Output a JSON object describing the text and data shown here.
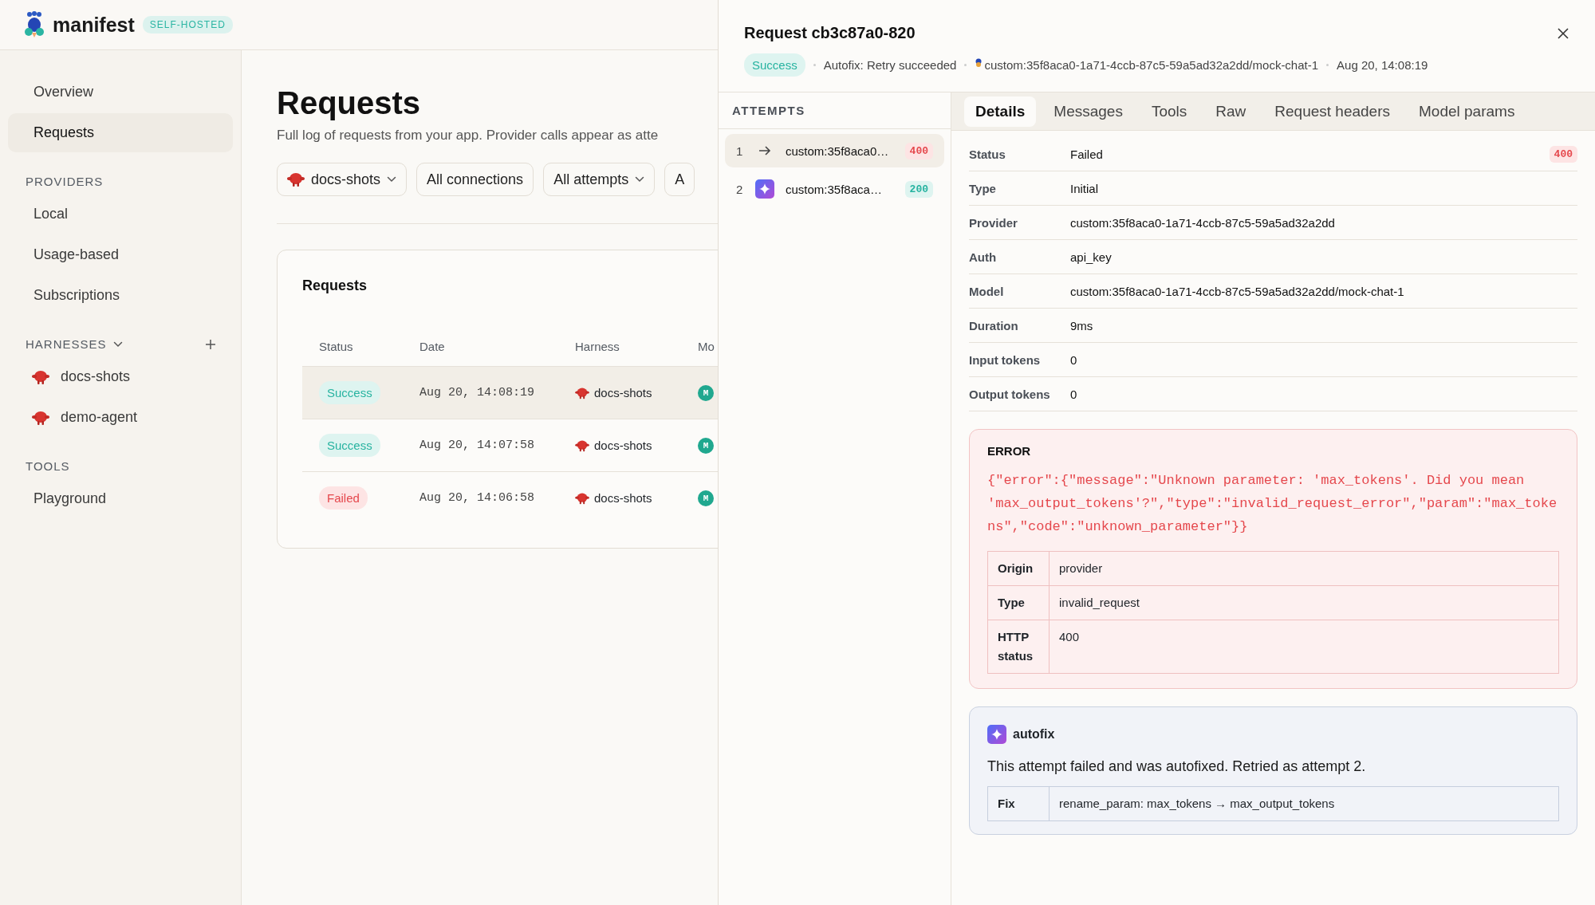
{
  "header": {
    "brand": "manifest",
    "badge": "SELF-HOSTED"
  },
  "sidebar": {
    "items": [
      {
        "label": "Overview",
        "selected": false
      },
      {
        "label": "Requests",
        "selected": true
      }
    ],
    "sections": [
      {
        "title": "PROVIDERS",
        "kind": "plain",
        "items": [
          {
            "label": "Local",
            "selected": false
          },
          {
            "label": "Usage-based",
            "selected": false
          },
          {
            "label": "Subscriptions",
            "selected": false
          }
        ]
      },
      {
        "title": "HARNESSES",
        "kind": "harness",
        "items": [
          {
            "label": "docs-shots",
            "selected": false
          },
          {
            "label": "demo-agent",
            "selected": false
          }
        ]
      },
      {
        "title": "TOOLS",
        "kind": "plain",
        "items": [
          {
            "label": "Playground",
            "selected": false
          }
        ]
      }
    ]
  },
  "page": {
    "title": "Requests",
    "subtitle": "Full log of requests from your app. Provider calls appear as atte",
    "filters": [
      {
        "label": "docs-shots",
        "kind": "harness"
      },
      {
        "label": "All connections",
        "kind": "plain"
      },
      {
        "label": "All attempts",
        "kind": "dropdown"
      },
      {
        "label": "A",
        "kind": "plain"
      }
    ],
    "table": {
      "title": "Requests",
      "columns": [
        "Status",
        "Date",
        "Harness",
        "Mo"
      ],
      "rows": [
        {
          "status": "Success",
          "kind": "success",
          "date": "Aug 20, 14:08:19",
          "harness": "docs-shots",
          "model": "M",
          "selected": true
        },
        {
          "status": "Success",
          "kind": "success",
          "date": "Aug 20, 14:07:58",
          "harness": "docs-shots",
          "model": "M",
          "selected": false
        },
        {
          "status": "Failed",
          "kind": "failed",
          "date": "Aug 20, 14:06:58",
          "harness": "docs-shots",
          "model": "M",
          "selected": false
        }
      ]
    }
  },
  "drawer": {
    "title": "Request cb3c87a0-820",
    "status": {
      "label": "Success",
      "kind": "success"
    },
    "autofix": "Autofix: Retry succeeded",
    "model": "custom:35f8aca0-1a71-4ccb-87c5-59a5ad32a2dd/mock-chat-1",
    "time": "Aug 20, 14:08:19",
    "attempts_title": "ATTEMPTS",
    "attempts": [
      {
        "number": "1",
        "kind": "initial",
        "provider": "custom:35f8aca0…",
        "code": "400",
        "failed": true,
        "selected": true
      },
      {
        "number": "2",
        "kind": "autofix",
        "provider": "custom:35f8aca…",
        "code": "200",
        "failed": false,
        "selected": false
      }
    ],
    "tabs": [
      {
        "label": "Details",
        "selected": true
      },
      {
        "label": "Messages",
        "selected": false
      },
      {
        "label": "Tools",
        "selected": false
      },
      {
        "label": "Raw",
        "selected": false
      },
      {
        "label": "Request headers",
        "selected": false
      },
      {
        "label": "Model params",
        "selected": false
      }
    ],
    "details": [
      {
        "label": "Status",
        "value": "Failed",
        "badge": "400"
      },
      {
        "label": "Type",
        "value": "Initial"
      },
      {
        "label": "Provider",
        "value": "custom:35f8aca0-1a71-4ccb-87c5-59a5ad32a2dd"
      },
      {
        "label": "Auth",
        "value": "api_key"
      },
      {
        "label": "Model",
        "value": "custom:35f8aca0-1a71-4ccb-87c5-59a5ad32a2dd/mock-chat-1"
      },
      {
        "label": "Duration",
        "value": "9ms"
      },
      {
        "label": "Input tokens",
        "value": "0"
      },
      {
        "label": "Output tokens",
        "value": "0"
      }
    ],
    "error": {
      "title": "ERROR",
      "message": "{\"error\":{\"message\":\"Unknown parameter: 'max_tokens'. Did you mean 'max_output_tokens'?\",\"type\":\"invalid_request_error\",\"param\":\"max_tokens\",\"code\":\"unknown_parameter\"}}",
      "fields": [
        {
          "label": "Origin",
          "value": "provider"
        },
        {
          "label": "Type",
          "value": "invalid_request"
        },
        {
          "label": "HTTP status",
          "value": "400"
        }
      ]
    },
    "autofix_card": {
      "title": "autofix",
      "text": "This attempt failed and was autofixed. Retried as attempt 2.",
      "fields": [
        {
          "label": "Fix",
          "value": "rename_param: max_tokens → max_output_tokens"
        }
      ]
    }
  }
}
